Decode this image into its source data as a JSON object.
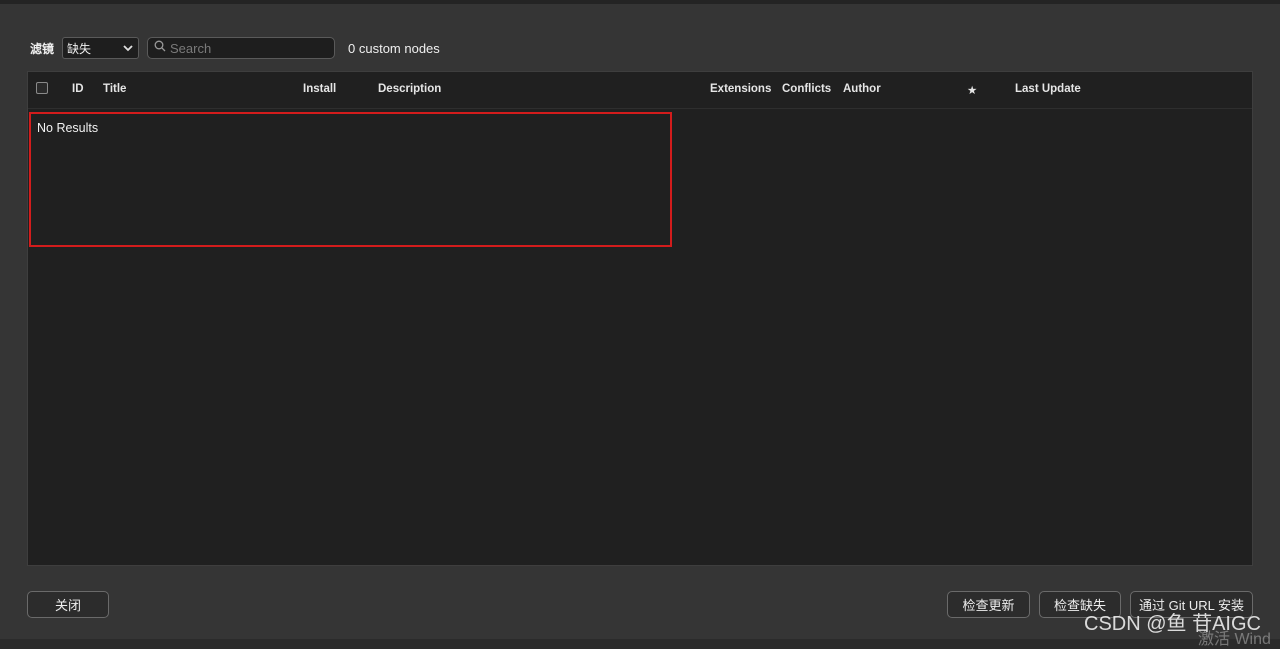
{
  "toolbar": {
    "filter_label": "滤镜",
    "filter_select": {
      "value": "缺失",
      "icon": "chevron-down-icon"
    },
    "search": {
      "placeholder": "Search",
      "value": "",
      "icon": "search-icon"
    },
    "count_text": "0 custom nodes"
  },
  "table": {
    "headers": {
      "id": "ID",
      "title": "Title",
      "install": "Install",
      "description": "Description",
      "extensions": "Extensions",
      "conflicts": "Conflicts",
      "author": "Author",
      "star": "★",
      "last_update": "Last Update"
    },
    "empty_message": "No Results",
    "highlight_color": "#d31c1c"
  },
  "footer": {
    "close_label": "关闭",
    "check_updates_label": "检查更新",
    "check_missing_label": "检查缺失",
    "install_git_url_label": "通过 Git URL 安装"
  },
  "watermark": {
    "text": "CSDN @鱼 苷AIGC",
    "sub_text": "激活 Wind"
  }
}
